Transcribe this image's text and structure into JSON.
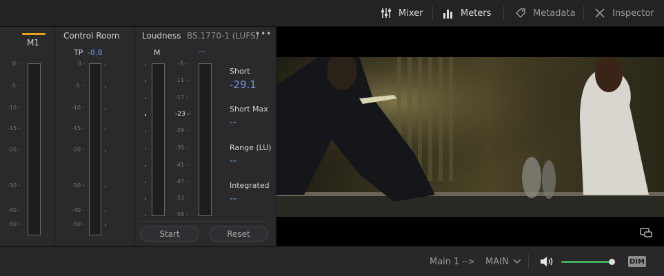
{
  "topbar": {
    "mixer": "Mixer",
    "meters": "Meters",
    "metadata": "Metadata",
    "inspector": "Inspector"
  },
  "meters": {
    "m1": {
      "title": "M1",
      "scale": [
        "0 -",
        "-5 -",
        "-10 -",
        "-15 -",
        "-20 -",
        "-30 -",
        "-40 -",
        "-50 -"
      ]
    },
    "control_room": {
      "title": "Control Room",
      "tp_label": "TP",
      "tp_value": "-8.8",
      "scale": [
        "0 -",
        "-5 -",
        "-10 -",
        "-15 -",
        "-20 -",
        "-30 -",
        "-40 -",
        "-50 -"
      ]
    },
    "loudness": {
      "title": "Loudness",
      "standard": "BS.1770-1 (LUFS)",
      "more": "•••",
      "m_label": "M",
      "dashes": "---",
      "scale": [
        "-5 -",
        "-11 -",
        "-17 -",
        "-23 -",
        "-29 -",
        "-35 -",
        "-41 -",
        "-47 -",
        "-53 -",
        "-59 -"
      ],
      "short_label": "Short",
      "short_value": "-29.1",
      "short_max_label": "Short Max",
      "short_max_value": "--",
      "range_label": "Range (LU)",
      "range_value": "--",
      "integrated_label": "Integrated",
      "integrated_value": "--",
      "start": "Start",
      "reset": "Reset"
    }
  },
  "bottombar": {
    "source": "Main 1",
    "arrow": "-->",
    "dest": "MAIN",
    "dim": "DIM",
    "volume_level": 0.95
  },
  "colors": {
    "accent_orange": "#e8a11b",
    "accent_blue": "#6f94d8"
  }
}
